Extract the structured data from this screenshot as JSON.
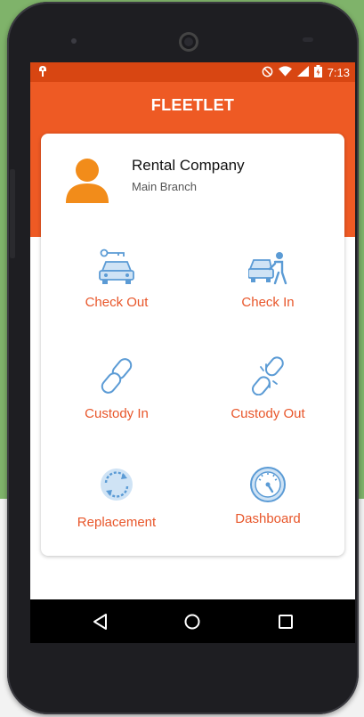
{
  "status_bar": {
    "time": "7:13"
  },
  "app_bar": {
    "title": "FLEETLET"
  },
  "profile": {
    "company": "Rental Company",
    "branch": "Main Branch"
  },
  "menu": [
    {
      "label": "Check Out",
      "icon": "car-key-icon"
    },
    {
      "label": "Check In",
      "icon": "car-person-icon"
    },
    {
      "label": "Custody In",
      "icon": "link-chain-icon"
    },
    {
      "label": "Custody Out",
      "icon": "broken-link-icon"
    },
    {
      "label": "Replacement",
      "icon": "refresh-icon"
    },
    {
      "label": "Dashboard",
      "icon": "speedometer-icon"
    }
  ],
  "colors": {
    "primary": "#ee5a24",
    "status_bar": "#d84612",
    "icon_blue": "#5b9bd5",
    "label": "#e8562a"
  }
}
